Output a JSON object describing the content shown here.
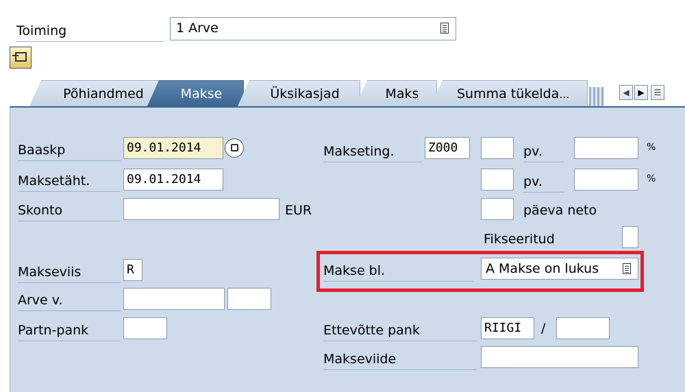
{
  "header": {
    "toiming_label": "Toiming",
    "toiming_value": "1 Arve"
  },
  "tabs": [
    {
      "label": "Põhiandmed",
      "active": false
    },
    {
      "label": "Makse",
      "active": true
    },
    {
      "label": "Üksikasjad",
      "active": false
    },
    {
      "label": "Maks",
      "active": false
    },
    {
      "label": "Summa tükelda",
      "active": false
    }
  ],
  "tab_overflow_marker": "…",
  "form": {
    "baaskp_label": "Baaskp",
    "baaskp_value": "09.01.2014",
    "maksetaht_label": "Maksetäht.",
    "maksetaht_value": "09.01.2014",
    "skonto_label": "Skonto",
    "skonto_value": "",
    "currency": "EUR",
    "makseviis_label": "Makseviis",
    "makseviis_value": "R",
    "arve_v_label": "Arve v.",
    "partn_pank_label": "Partn-pank",
    "makseting_label": "Makseting.",
    "makseting_value": "Z000",
    "pv1_label": "pv.",
    "pv2_label": "pv.",
    "paeva_neto_label": "päeva neto",
    "pct_symbol_1": "%",
    "pct_symbol_2": "%",
    "fikseeritud_label": "Fikseeritud",
    "makse_bl_label": "Makse bl.",
    "makse_bl_value": "A Makse on lukus",
    "ettevotte_pank_label": "Ettevõtte pank",
    "ettevotte_pank_value": "RIIGI",
    "slash": "/",
    "makseviide_label": "Makseviide"
  },
  "colors": {
    "panel_bg": "#cddbea",
    "active_tab": "#3b6592",
    "highlight_box": "#e0202e"
  }
}
